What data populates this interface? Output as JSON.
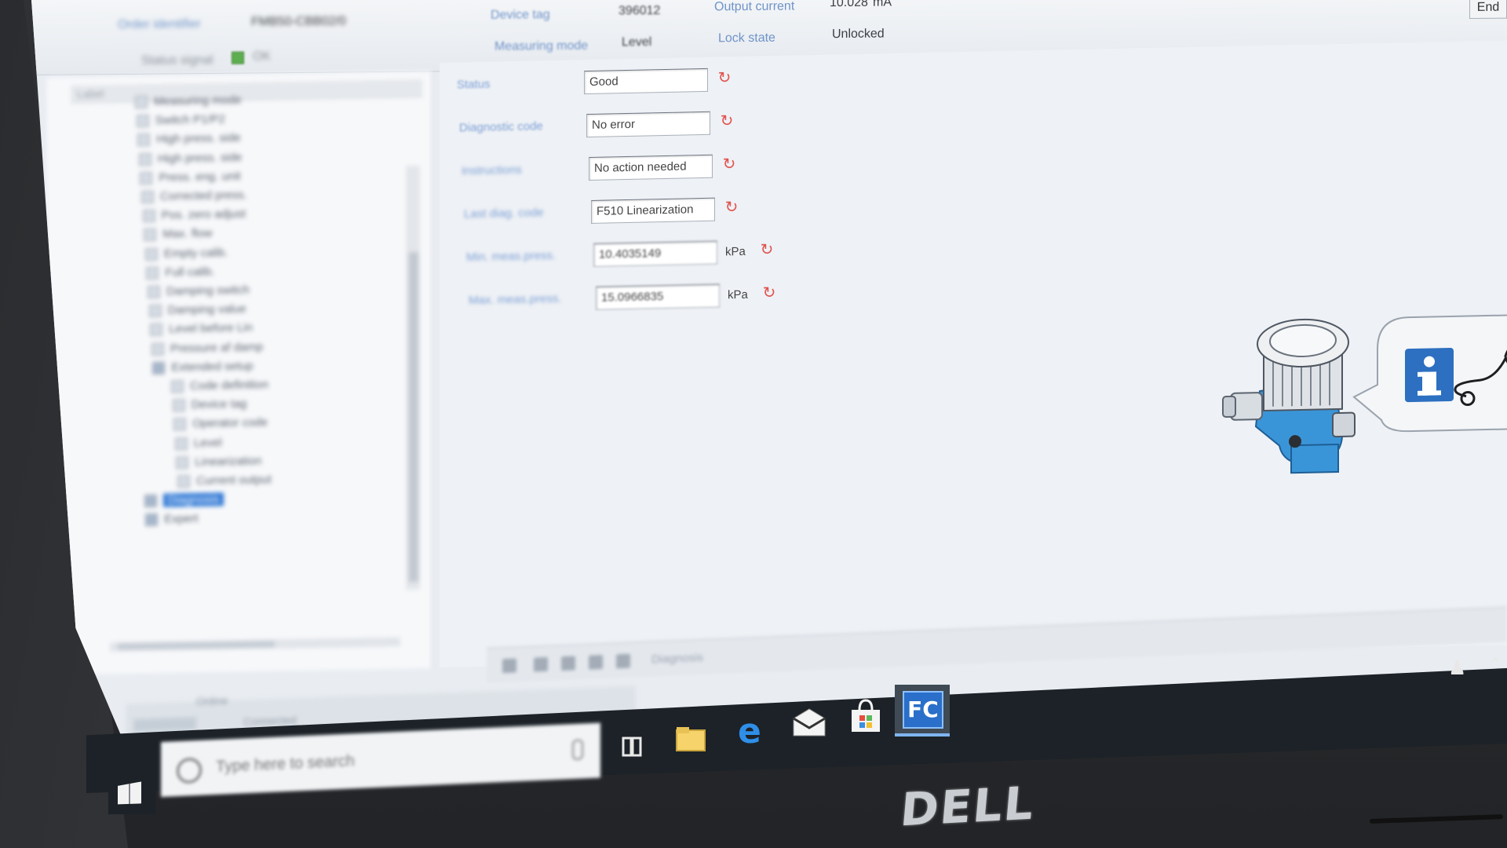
{
  "header": {
    "order_ident_label": "Order identifier",
    "order_ident_value": "FMB50-CBB02/0",
    "status_signal_label": "Status signal",
    "status_signal_value": "OK",
    "device_tag_label": "Device tag",
    "device_tag_value": "396012",
    "measuring_mode_label": "Measuring mode",
    "measuring_mode_value": "Level",
    "output_current_label": "Output current",
    "output_current_value": "10.028",
    "output_current_unit": "mA",
    "lock_state_label": "Lock state",
    "lock_state_value": "Unlocked",
    "end_button": "End"
  },
  "tree": {
    "header": "Label",
    "items": [
      {
        "label": "Measuring mode",
        "indent": 1
      },
      {
        "label": "Switch P1/P2",
        "indent": 1
      },
      {
        "label": "High press. side",
        "indent": 1
      },
      {
        "label": "High press. side",
        "indent": 1
      },
      {
        "label": "Press. eng. unit",
        "indent": 1
      },
      {
        "label": "Corrected press.",
        "indent": 1
      },
      {
        "label": "Pos. zero adjust",
        "indent": 1
      },
      {
        "label": "Max. flow",
        "indent": 1
      },
      {
        "label": "Empty calib.",
        "indent": 1
      },
      {
        "label": "Full calib.",
        "indent": 1
      },
      {
        "label": "Damping switch",
        "indent": 1
      },
      {
        "label": "Damping value",
        "indent": 1
      },
      {
        "label": "Level before Lin",
        "indent": 1
      },
      {
        "label": "Pressure af damp",
        "indent": 1
      },
      {
        "label": "Extended setup",
        "indent": 1
      },
      {
        "label": "Code definition",
        "indent": 2
      },
      {
        "label": "Device tag",
        "indent": 2
      },
      {
        "label": "Operator code",
        "indent": 2
      },
      {
        "label": "Level",
        "indent": 2
      },
      {
        "label": "Linearization",
        "indent": 2
      },
      {
        "label": "Current output",
        "indent": 2
      },
      {
        "label": "Diagnosis",
        "indent": 0,
        "selected": true
      },
      {
        "label": "Expert",
        "indent": 0
      }
    ]
  },
  "diagnostics": {
    "fields": [
      {
        "label": "Status",
        "value": "Good",
        "unit": ""
      },
      {
        "label": "Diagnostic code",
        "value": "No error",
        "unit": ""
      },
      {
        "label": "Instructions",
        "value": "No action needed",
        "unit": ""
      },
      {
        "label": "Last diag. code",
        "value": "F510 Linearization",
        "unit": ""
      },
      {
        "label": "Min. meas.press.",
        "value": "10.4035149",
        "unit": "kPa"
      },
      {
        "label": "Max. meas.press.",
        "value": "15.0966835",
        "unit": "kPa"
      }
    ]
  },
  "toolbar": {
    "label": "Diagnosis"
  },
  "status_bar": {
    "left_label": "Online",
    "connection": "Connected"
  },
  "taskbar": {
    "search_placeholder": "Type here to search",
    "apps": [
      "task-view",
      "file-explorer",
      "edge",
      "mail",
      "store",
      "fieldcare"
    ],
    "active_app_text": "FC"
  },
  "brand": "DELL",
  "colors": {
    "accent": "#2f78d5",
    "label_blue": "#7c9fd6",
    "refresh_red": "#e0524e",
    "device_blue": "#3a95d8",
    "info_blue": "#2d6fc0"
  }
}
